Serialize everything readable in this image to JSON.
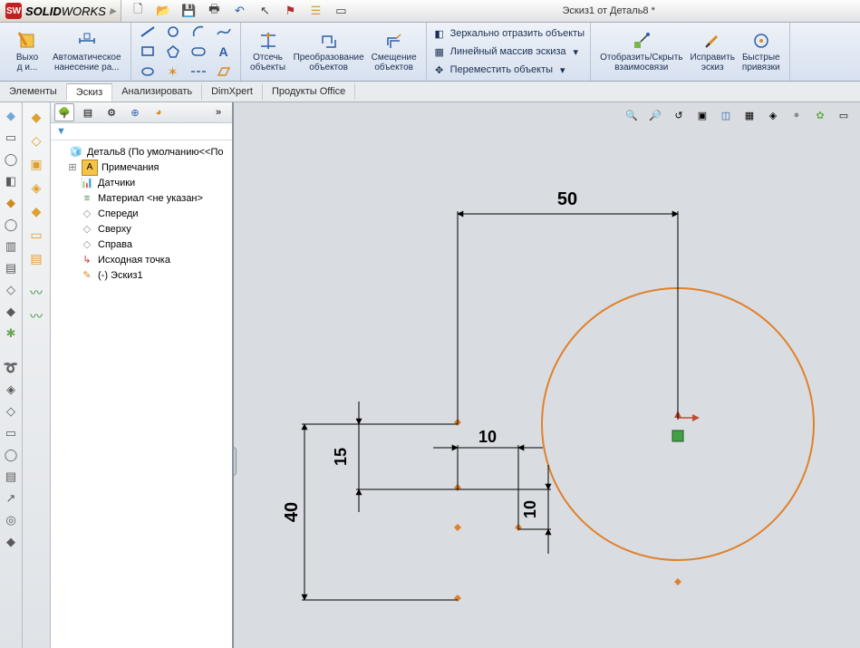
{
  "app": {
    "brand_initials": "SW",
    "brand_name1": "SOLID",
    "brand_name2": "WORKS",
    "doc_title": "Эскиз1 от Деталь8 *"
  },
  "ribbon": {
    "exit_insert": "Выхо\nд и...",
    "smart_dim": "Автоматическое\nнанесение ра...",
    "trim": "Отсечь\nобъекты",
    "convert": "Преобразование\nобъектов",
    "offset": "Смещение\nобъектов",
    "mirror": "Зеркально отразить объекты",
    "linear_pattern": "Линейный массив эскиза",
    "move": "Переместить объекты",
    "show_hide": "Отобразить/Скрыть\nвзаимосвязи",
    "fix_sketch": "Исправить\nэскиз",
    "quick_snaps": "Быстрые\nпривязки"
  },
  "cmd_tabs": {
    "t1": "Элементы",
    "t2": "Эскиз",
    "t3": "Анализировать",
    "t4": "DimXpert",
    "t5": "Продукты Office"
  },
  "fm": {
    "filter_placeholder": "",
    "root": "Деталь8  (По умолчанию<<По",
    "annotations": "Примечания",
    "sensors": "Датчики",
    "material": "Материал <не указан>",
    "front": "Спереди",
    "top": "Сверху",
    "right": "Справа",
    "origin": "Исходная точка",
    "sketch": "(-) Эскиз1"
  },
  "drawing": {
    "dim50": "50",
    "dim40": "40",
    "dim15": "15",
    "dim10a": "10",
    "dim10b": "10"
  }
}
